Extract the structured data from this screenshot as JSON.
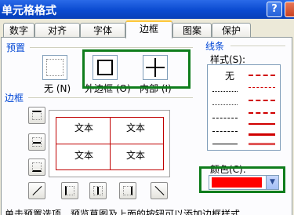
{
  "window": {
    "title": "单元格格式",
    "help_label": "?"
  },
  "tabs": [
    {
      "label": "数字",
      "active": false
    },
    {
      "label": "对齐",
      "active": false
    },
    {
      "label": "字体",
      "active": false
    },
    {
      "label": "边框",
      "active": true
    },
    {
      "label": "图案",
      "active": false
    },
    {
      "label": "保护",
      "active": false
    }
  ],
  "presets": {
    "section_label": "预置",
    "none_label": "无 (N)",
    "outline_label": "外边框 (O)",
    "inside_label": "内部 (I)"
  },
  "border": {
    "section_label": "边框",
    "preview_cells": [
      "文本",
      "文本",
      "文本",
      "文本"
    ]
  },
  "line": {
    "section_label": "线条",
    "style_label": "样式(S):",
    "none_style": "无",
    "color_label": "颜色(C):",
    "selected_color": "#ff0000",
    "arrow_glyph": "▼"
  },
  "hint": "单击预置选项、预览草图及上面的按钮可以添加边框样式。",
  "colors": {
    "accent_green": "#0f7d1c",
    "border_red": "#c00000"
  }
}
